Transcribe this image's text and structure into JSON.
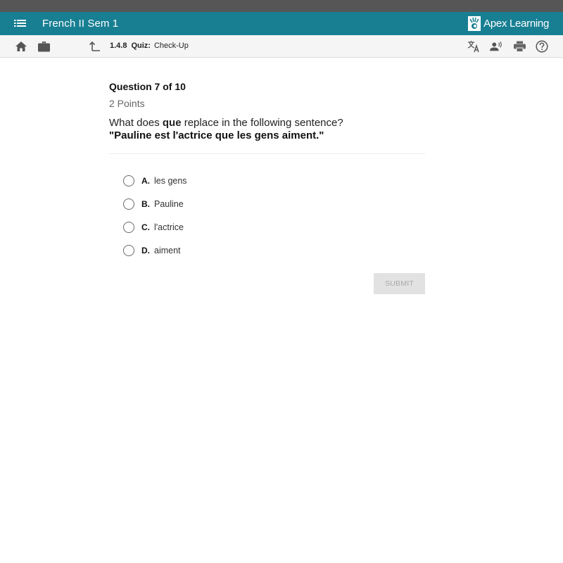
{
  "appbar": {
    "course_title": "French II Sem 1",
    "brand": "Apex Learning",
    "colors": {
      "appbar": "#187f93",
      "top_strip": "#565656"
    }
  },
  "toolbar": {
    "lesson_number": "1.4.8",
    "lesson_type": "Quiz:",
    "lesson_title": "Check-Up",
    "left_icons": [
      "home-icon",
      "briefcase-icon",
      "up-arrow-icon"
    ],
    "right_icons": [
      "translate-icon",
      "text-to-speech-icon",
      "print-icon",
      "help-icon"
    ]
  },
  "question": {
    "number_label": "Question 7 of 10",
    "points": "2 Points",
    "prompt_before": "What does ",
    "prompt_bold": "que",
    "prompt_after": " replace in the following sentence?",
    "sentence": "\"Pauline est l'actrice que les gens aiment.\""
  },
  "options": [
    {
      "letter": "A.",
      "text": "les gens",
      "selected": false
    },
    {
      "letter": "B.",
      "text": "Pauline",
      "selected": false
    },
    {
      "letter": "C.",
      "text": "l'actrice",
      "selected": false
    },
    {
      "letter": "D.",
      "text": "aiment",
      "selected": false
    }
  ],
  "submit": {
    "label": "SUBMIT",
    "enabled": false
  }
}
